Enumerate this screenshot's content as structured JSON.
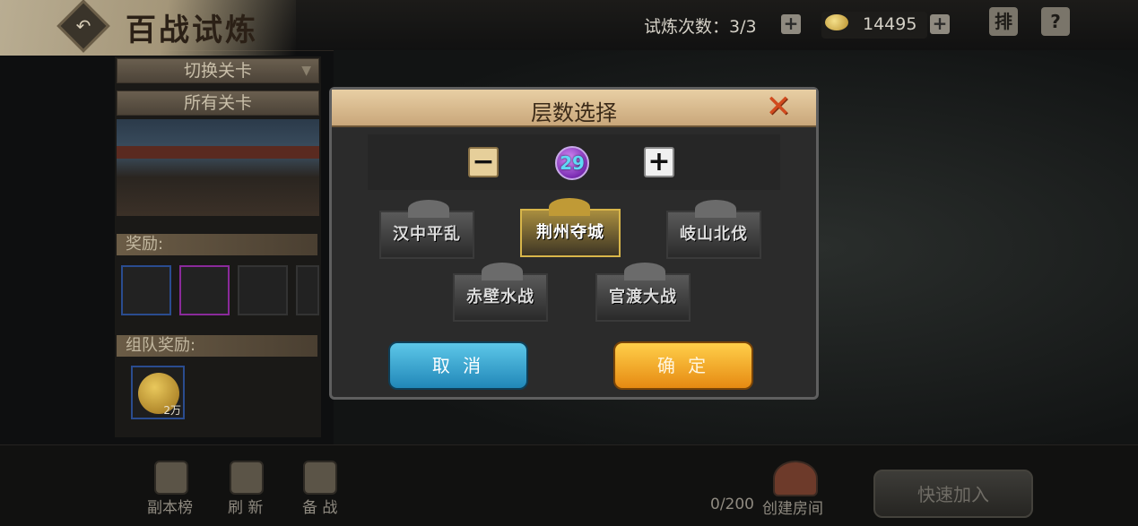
{
  "header": {
    "title": "百战试炼",
    "trial_label": "试炼次数：3/3",
    "gold_amount": "14495",
    "rank_button": "排",
    "help_button": "?"
  },
  "left_panel": {
    "switch_stage": "切换关卡",
    "all_stages": "所有关卡",
    "reward_label": "奖励:",
    "team_reward_label": "组队奖励:",
    "team_reward_amount": "2万"
  },
  "dialog": {
    "title": "层数选择",
    "level": "29",
    "stages": [
      {
        "name": "汉中平乱",
        "selected": false
      },
      {
        "name": "荆州夺城",
        "selected": true
      },
      {
        "name": "岐山北伐",
        "selected": false
      },
      {
        "name": "赤壁水战",
        "selected": false
      },
      {
        "name": "官渡大战",
        "selected": false
      }
    ],
    "cancel_label": "取 消",
    "confirm_label": "确 定"
  },
  "bottom": {
    "rank_label": "副本榜",
    "refresh_label": "刷 新",
    "prepare_label": "备 战",
    "room_count": "0/200",
    "create_room_label": "创建房间",
    "quick_join_label": "快速加入"
  },
  "colors": {
    "cancel_button": "#2f9fcf",
    "confirm_button": "#f2a51c",
    "selected_card_border": "#d8b64a",
    "level_orb": "#8e3fc4"
  }
}
